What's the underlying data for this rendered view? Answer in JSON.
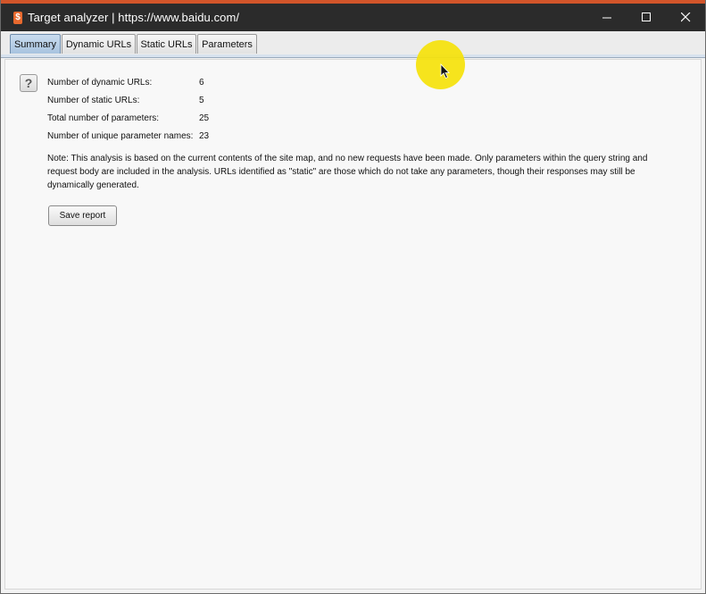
{
  "window": {
    "title": "Target analyzer | https://www.baidu.com/",
    "app_icon_glyph": "$",
    "controls": {
      "minimize": "minimize-icon",
      "maximize": "maximize-icon",
      "close": "close-icon"
    }
  },
  "tabs": [
    {
      "label": "Summary",
      "active": true
    },
    {
      "label": "Dynamic URLs",
      "active": false
    },
    {
      "label": "Static URLs",
      "active": false
    },
    {
      "label": "Parameters",
      "active": false
    }
  ],
  "summary": {
    "help_glyph": "?",
    "stats": [
      {
        "label": "Number of dynamic URLs:",
        "value": "6"
      },
      {
        "label": "Number of static URLs:",
        "value": "5"
      },
      {
        "label": "Total number of parameters:",
        "value": "25"
      },
      {
        "label": "Number of unique parameter names:",
        "value": "23"
      }
    ],
    "note": "Note: This analysis is based on the current contents of the site map, and no new requests have been made. Only parameters within the query string and request body are included in the analysis. URLs identified as \"static\" are those which do not take any parameters, though their responses may still be dynamically generated.",
    "save_button_label": "Save report"
  },
  "colors": {
    "title_bar": "#2b2b2b",
    "accent": "#d2552a",
    "active_tab": "#a8c3df",
    "cursor_highlight": "#f5e20a"
  }
}
